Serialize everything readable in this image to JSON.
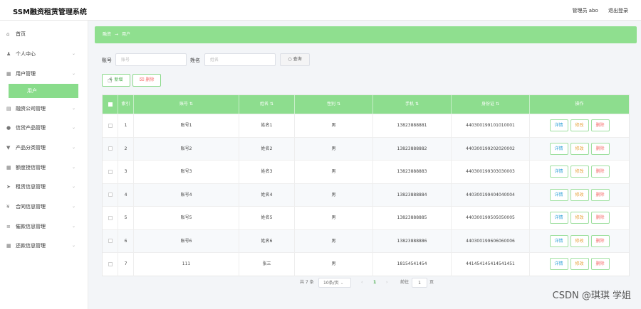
{
  "header": {
    "app_title": "SSM融资租赁管理系统",
    "user_label": "管理员 abo",
    "logout_label": "退出登录"
  },
  "sidebar": {
    "items": [
      {
        "label": "首页",
        "icon": "home-icon",
        "glyph": "⌂",
        "has_children": false
      },
      {
        "label": "个人中心",
        "icon": "person-icon",
        "glyph": "♟",
        "has_children": true
      },
      {
        "label": "用户管理",
        "icon": "grid-icon",
        "glyph": "▦",
        "has_children": true
      },
      {
        "label": "融资公司管理",
        "icon": "chat-icon",
        "glyph": "▤",
        "has_children": true
      },
      {
        "label": "信贷产品管理",
        "icon": "circle-icon",
        "glyph": "●",
        "has_children": true
      },
      {
        "label": "产品分类管理",
        "icon": "shirt-icon",
        "glyph": "▼",
        "has_children": true
      },
      {
        "label": "额度授信管理",
        "icon": "grid-icon",
        "glyph": "▦",
        "has_children": true
      },
      {
        "label": "租赁信息管理",
        "icon": "send-icon",
        "glyph": "➤",
        "has_children": true
      },
      {
        "label": "合同信息管理",
        "icon": "coin-icon",
        "glyph": "¥",
        "has_children": true
      },
      {
        "label": "催款信息管理",
        "icon": "stack-icon",
        "glyph": "≡",
        "has_children": true
      },
      {
        "label": "还款信息管理",
        "icon": "grid-icon",
        "glyph": "▦",
        "has_children": true
      }
    ],
    "active_sub_item": "用户"
  },
  "breadcrumb": {
    "root": "融资",
    "separator": "→",
    "current": "用户"
  },
  "search": {
    "account_label": "账号",
    "account_placeholder": "账号",
    "account_value": "",
    "name_label": "姓名",
    "name_placeholder": "姓名",
    "name_value": "",
    "query_icon": "search-icon",
    "query_label": "查询"
  },
  "actions": {
    "add_label": "新增",
    "delete_label": "删除"
  },
  "table": {
    "columns": [
      "索引",
      "账号",
      "姓名",
      "性别",
      "手机",
      "身份证",
      "操作"
    ],
    "rows": [
      {
        "index": "1",
        "account": "账号1",
        "name": "姓名1",
        "gender": "男",
        "phone": "13823888881",
        "id_card": "440300199101010001"
      },
      {
        "index": "2",
        "account": "账号2",
        "name": "姓名2",
        "gender": "男",
        "phone": "13823888882",
        "id_card": "440300199202020002"
      },
      {
        "index": "3",
        "account": "账号3",
        "name": "姓名3",
        "gender": "男",
        "phone": "13823888883",
        "id_card": "440300199303030003"
      },
      {
        "index": "4",
        "account": "账号4",
        "name": "姓名4",
        "gender": "男",
        "phone": "13823888884",
        "id_card": "440300199404040004"
      },
      {
        "index": "5",
        "account": "账号5",
        "name": "姓名5",
        "gender": "男",
        "phone": "13823888885",
        "id_card": "440300199505050005"
      },
      {
        "index": "6",
        "account": "账号6",
        "name": "姓名6",
        "gender": "男",
        "phone": "13823888886",
        "id_card": "440300199606060006"
      },
      {
        "index": "7",
        "account": "111",
        "name": "张三",
        "gender": "男",
        "phone": "18154541454",
        "id_card": "441454145414541451"
      }
    ],
    "op_detail": "详情",
    "op_edit": "修改",
    "op_delete": "删除"
  },
  "pagination": {
    "total": "共 7 条",
    "page_size": "10条/页",
    "current_page": "1",
    "goto_label": "前往",
    "goto_value": "1",
    "page_unit": "页"
  },
  "watermark": "CSDN @琪琪 学姐",
  "colors": {
    "accent_green": "#8ddd8e",
    "detail_blue": "#36a3d9",
    "edit_orange": "#e6a23c",
    "delete_red": "#f56c6c"
  }
}
